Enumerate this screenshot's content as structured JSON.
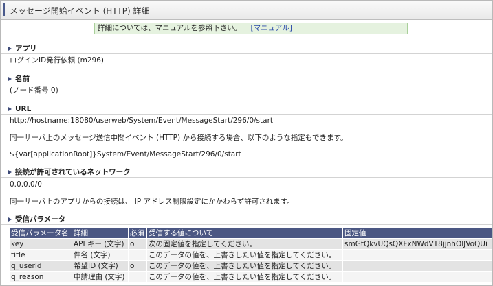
{
  "header": {
    "title": "メッセージ開始イベント (HTTP) 詳細"
  },
  "notice": {
    "text": "詳細については、マニュアルを参照下さい。",
    "link": "[マニュアル]"
  },
  "app": {
    "heading": "アプリ",
    "value": "ログインID発行依頼 (m296)"
  },
  "name": {
    "heading": "名前",
    "value": "(ノード番号 0)"
  },
  "url": {
    "heading": "URL",
    "value": "http://hostname:18080/userweb/System/Event/MessageStart/296/0/start",
    "note": "同一サーバ上のメッセージ送信中間イベント (HTTP) から接続する場合、以下のような指定もできます。",
    "alt": "${var[applicationRoot]}System/Event/MessageStart/296/0/start"
  },
  "network": {
    "heading": "接続が許可されているネットワーク",
    "value": "0.0.0.0/0",
    "note": "同一サーバ上のアプリからの接続は、 IP アドレス制限設定にかかわらず許可されます。"
  },
  "params": {
    "heading": "受信パラメータ",
    "columns": [
      "受信パラメータ名",
      "詳細",
      "必須",
      "受信する値について",
      "固定値"
    ],
    "rows": [
      {
        "name": "key",
        "detail": "API キー (文字)",
        "required": "o",
        "about": "次の固定値を指定してください。",
        "fixed": "smGtQkvUQsQXFxNWdVT8jjnhOlJVoQUi"
      },
      {
        "name": "title",
        "detail": "件名 (文字)",
        "required": "",
        "about": "このデータの値を、上書きしたい値を指定してください。",
        "fixed": ""
      },
      {
        "name": "q_userId",
        "detail": "希望ID (文字)",
        "required": "o",
        "about": "このデータの値を、上書きしたい値を指定してください。",
        "fixed": ""
      },
      {
        "name": "q_reason",
        "detail": "申請理由 (文字)",
        "required": "",
        "about": "このデータの値を、上書きしたい値を指定してください。",
        "fixed": ""
      }
    ]
  }
}
